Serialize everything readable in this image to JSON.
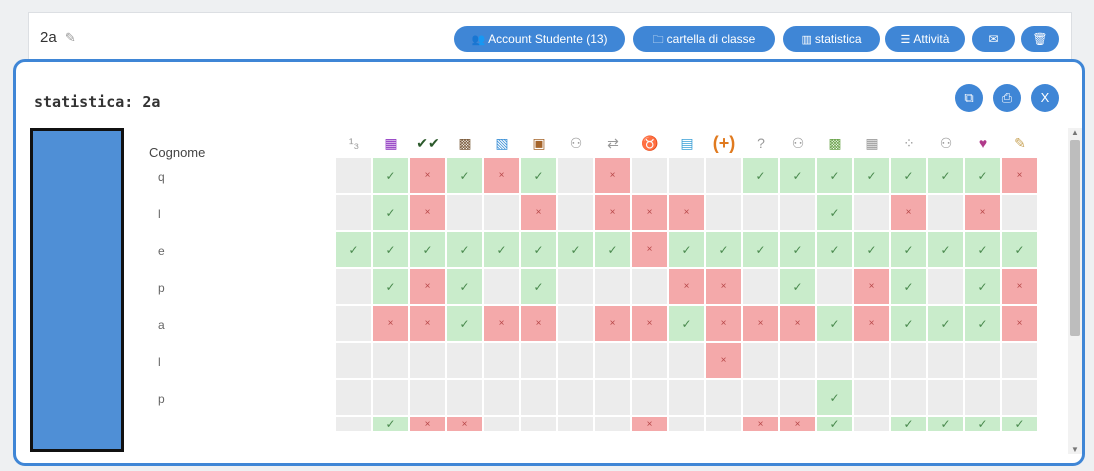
{
  "class_bar": {
    "class_name": "2a",
    "buttons": {
      "accounts": "Account Studente (13)",
      "folder": "cartella di classe",
      "stats": "statistica",
      "activities": "Attività"
    }
  },
  "modal": {
    "title": "statistica: 2a",
    "column_header": "Cognome",
    "close_label": "X"
  },
  "students": [
    "q",
    "l",
    "e",
    "p",
    "a",
    "l",
    "p"
  ],
  "grid": [
    [
      "e",
      "ok",
      "x",
      "ok",
      "x",
      "ok",
      "e",
      "x",
      "e",
      "e",
      "e",
      "ok",
      "ok",
      "ok",
      "ok",
      "ok",
      "ok",
      "ok",
      "x"
    ],
    [
      "e",
      "ok",
      "x",
      "e",
      "e",
      "x",
      "e",
      "x",
      "x",
      "x",
      "e",
      "e",
      "e",
      "ok",
      "e",
      "x",
      "e",
      "x",
      "e"
    ],
    [
      "ok",
      "ok",
      "ok",
      "ok",
      "ok",
      "ok",
      "ok",
      "ok",
      "x",
      "ok",
      "ok",
      "ok",
      "ok",
      "ok",
      "ok",
      "ok",
      "ok",
      "ok",
      "ok"
    ],
    [
      "e",
      "ok",
      "x",
      "ok",
      "e",
      "ok",
      "e",
      "e",
      "e",
      "x",
      "x",
      "e",
      "ok",
      "e",
      "x",
      "ok",
      "e",
      "ok",
      "x"
    ],
    [
      "e",
      "x",
      "x",
      "ok",
      "x",
      "x",
      "e",
      "x",
      "x",
      "ok",
      "x",
      "x",
      "x",
      "ok",
      "x",
      "ok",
      "ok",
      "ok",
      "x"
    ],
    [
      "e",
      "e",
      "e",
      "e",
      "e",
      "e",
      "e",
      "e",
      "e",
      "e",
      "x",
      "e",
      "e",
      "e",
      "e",
      "e",
      "e",
      "e",
      "e"
    ],
    [
      "e",
      "e",
      "e",
      "e",
      "e",
      "e",
      "e",
      "e",
      "e",
      "e",
      "e",
      "e",
      "e",
      "ok",
      "e",
      "e",
      "e",
      "e",
      "e"
    ],
    [
      "e",
      "ok",
      "x",
      "x",
      "e",
      "e",
      "e",
      "e",
      "x",
      "e",
      "e",
      "x",
      "x",
      "ok",
      "e",
      "ok",
      "ok",
      "ok",
      "ok"
    ]
  ],
  "marks": {
    "ok": "✓",
    "x": "×"
  },
  "colors": {
    "accent": "#3f86d6",
    "ok_bg": "#c9eccb",
    "x_bg": "#f4a9aa",
    "empty_bg": "#ececec"
  },
  "activity_icons": [
    "tally-icon",
    "purple-image-icon",
    "double-check-icon",
    "mosaic-icon",
    "blue-image-icon",
    "calendar-icon",
    "people-icon",
    "arrows-icon",
    "goat-icon",
    "landscape-icon",
    "plus-icon",
    "question-icon",
    "people-icon",
    "puzzle-icon",
    "grid-icon",
    "dots-icon",
    "people-icon",
    "hearts-icon",
    "pencil-icon"
  ]
}
